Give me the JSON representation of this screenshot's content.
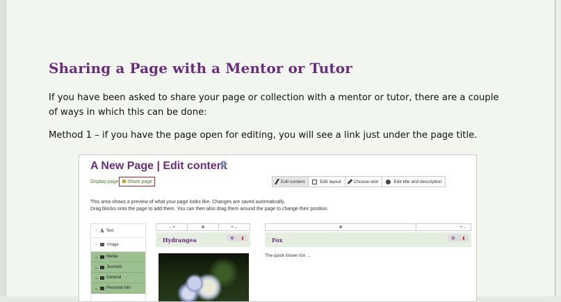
{
  "document": {
    "title": "Sharing a Page with a Mentor or Tutor",
    "paragraph1": "If you have been asked to share your page or collection with a mentor or tutor, there are a couple of ways in which this can be done:",
    "paragraph2": "Method 1 – if you have the page open for editing, you will see a link just under the page title."
  },
  "screenshot": {
    "page_title": "A New Page | Edit content",
    "display_page": "Display page",
    "share_page": "Share page",
    "toolbar": [
      "Edit content",
      "Edit layout",
      "Choose skin",
      "Edit title and description"
    ],
    "intro_line1": "This area shows a preview of what your page looks like. Changes are saved automatically.",
    "intro_line2": "Drag blocks onto the page to add them. You can then also drag them around the page to change their position.",
    "sidebar_items": [
      "Text",
      "Image"
    ],
    "sidebar_categories": [
      "Media",
      "Journals",
      "General",
      "Personal info"
    ],
    "column_controls": {
      "left": "←+",
      "center": "⊗",
      "right": "+→"
    },
    "blocks": {
      "hydrangea": "Hydrangea",
      "fox": "Fox",
      "fox_text": "The quick brown fox ..."
    },
    "icons": {
      "config": "gear-icon",
      "delete": "trash-icon",
      "info": "info-icon",
      "lock": "lock-icon"
    }
  },
  "colors": {
    "title": "#6b2c7f",
    "link": "#4f7a2a",
    "highlight_box": "#b21e24",
    "category": "#9cc08f"
  }
}
